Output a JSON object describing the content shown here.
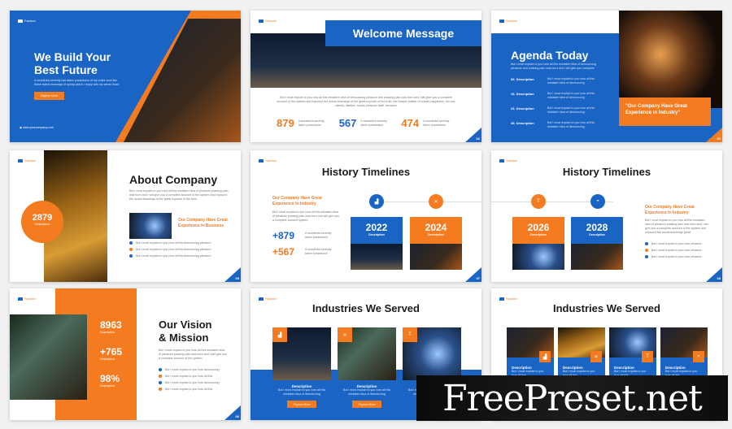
{
  "brand": "Factora",
  "colors": {
    "blue": "#1a64c4",
    "orange": "#f47b20"
  },
  "body_text": "But I must explain to you how all this mistaken idea of denouncing pleasure and praising pain was born and I will give you a complete account of the system",
  "short_text": "But I must explain to you how all this mistaken idea of denouncing",
  "slide1": {
    "title_line1": "We Build Your",
    "title_line2": "Best Future",
    "subtitle": "A wonderful serenity has taken possession of my entire soul like these sweet mornings of spring which I enjoy with my whole heart",
    "button": "Explore More",
    "website": "www.yourcompany.com"
  },
  "slide2": {
    "title": "Welcome Message",
    "paragraph": "But I must explain to you how all this mistaken idea of denouncing pleasure and praising pain was born and I will give you a complete account of the system and expound the actual teachings of the great explorer of the truth, the master-builder of human happiness. No one rejects, dislikes, avoids pleasure itself, because",
    "stats": [
      {
        "value": "879",
        "label": "A wonderful serenity taken possession"
      },
      {
        "value": "567",
        "label": "A wonderful serenity taken possession"
      },
      {
        "value": "474",
        "label": "A wonderful serenity taken possession"
      }
    ],
    "page": "02"
  },
  "slide3": {
    "title": "Agenda Today",
    "intro": "But I must explain to you how all this mistaken idea of denouncing pleasure and praising pain was born and I will give you complete",
    "items": [
      {
        "num": "06.",
        "label": "Description",
        "text": "But I must explain to you how all this mistaken idea of denouncing"
      },
      {
        "num": "16.",
        "label": "Description",
        "text": "But I must explain to you how all this mistaken idea of denouncing"
      },
      {
        "num": "23.",
        "label": "Description",
        "text": "But I must explain to you how all this mistaken idea of denouncing"
      },
      {
        "num": "28.",
        "label": "Description",
        "text": "But I must explain to you how all this mistaken idea of denouncing"
      }
    ],
    "quote": "\"Our Company Have Great Experience in Industry\"",
    "page": "03"
  },
  "slide4": {
    "title": "About Company",
    "paragraph": "But I must explain to you how all this mistaken idea of pleasure praising pain was born and I will give you a complete account of the system and expound the actual teachings of the great explorer of the truth",
    "stat_value": "2879",
    "stat_label": "Description",
    "subhead": "Our Company Have Great Experience In Business",
    "bullets": [
      "But I must explain to you how all this denouncing pleasure",
      "But I must explain to you how all this denouncing pleasure",
      "But I must explain to you how all this denouncing pleasure"
    ],
    "page": "05"
  },
  "slide5": {
    "title": "History Timelines",
    "subhead": "Our Company Have Great Experience In Industry",
    "paragraph": "But I must explain to you how all this mistaken idea of pleasure praising pain was born and will give you a complete account system",
    "stats": [
      {
        "value": "+879",
        "label": "A wonderful serenity taken possession"
      },
      {
        "value": "+567",
        "label": "A wonderful serenity taken possession"
      }
    ],
    "cards": [
      {
        "year": "2022",
        "label": "Description",
        "icon": "factory-icon"
      },
      {
        "year": "2024",
        "label": "Description",
        "icon": "hammer-wrench-icon"
      }
    ],
    "page": "07"
  },
  "slide6": {
    "title": "History Timelines",
    "subhead": "Our Company Have Great Experience In Industry",
    "paragraph": "But I must explain to you how all this mistaken idea of pleasure praising pain was born and I will give you a complete account of the system and expound the actual teachings great",
    "cards": [
      {
        "year": "2026",
        "label": "Description",
        "icon": "drill-icon"
      },
      {
        "year": "2028",
        "label": "Description",
        "icon": "hard-hat-icon"
      }
    ],
    "bullets": [
      "But I must explain to you how pleasure",
      "But I must explain to you how pleasure",
      "But I must explain to you how pleasure"
    ],
    "page": "08"
  },
  "slide7": {
    "title_line1": "Our Vision",
    "title_line2": "& Mission",
    "paragraph": "But I must explain to you how all this mistaken idea of pleasure praising pain was born and I will give you a complete account of the system",
    "stats": [
      {
        "value": "8963",
        "label": "Description"
      },
      {
        "value": "+765",
        "label": "Description"
      },
      {
        "value": "98%",
        "label": "Description"
      }
    ],
    "bullets": [
      "But I must explain to you how denouncing",
      "But I must explain to you how all this",
      "But I must explain to you how denouncing",
      "But I must explain to you how all this"
    ],
    "page": "06"
  },
  "slide8": {
    "title": "Industries We Served",
    "cards": [
      {
        "label": "Description",
        "text": "But I must explain to you how all this mistaken idea of denouncing",
        "button": "Explore More"
      },
      {
        "label": "Description",
        "text": "But I must explain to you how all this mistaken idea of denouncing",
        "button": "Explore More"
      },
      {
        "label": "Description",
        "text": "But I must explain to you how all this mistaken idea of denouncing",
        "button": "Explore More"
      }
    ]
  },
  "slide9": {
    "title": "Industries We Served",
    "cards": [
      {
        "label": "Description",
        "text": "But I must explain to you how all this"
      },
      {
        "label": "Description",
        "text": "But I must explain to you how all this"
      },
      {
        "label": "Description",
        "text": "But I must explain to you how all this"
      },
      {
        "label": "Description",
        "text": "But I must explain to you how all this"
      }
    ]
  },
  "watermark": "FreePreset.net"
}
